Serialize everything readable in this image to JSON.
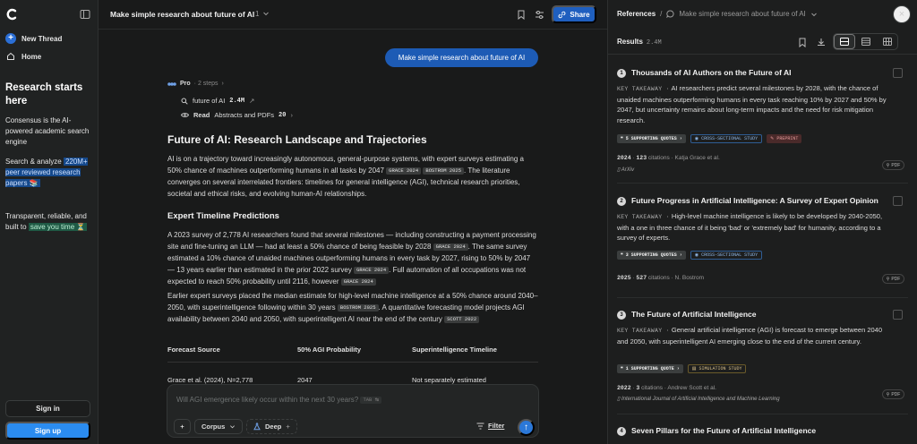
{
  "sidebar": {
    "new_thread": "New Thread",
    "home": "Home",
    "promo_title": "Research starts here",
    "promo_1": "Consensus is the AI-powered academic search engine",
    "promo_2_a": "Search & analyze",
    "promo_2_hl": "220M+ peer reviewed research papers 📚",
    "promo_3_a": "Transparent, reliable, and built to",
    "promo_3_hl": "save you time ⏳",
    "signin": "Sign in",
    "signup": "Sign up"
  },
  "topbar": {
    "title": "Make simple research about future of AI",
    "count": "1",
    "share": "Share"
  },
  "thread": {
    "user_query": "Make simple research about future of AI",
    "pro_label": "Pro",
    "steps": "· 2 steps",
    "step1_text": "future of AI",
    "step1_count": "2.4M",
    "step2_label": "Read",
    "step2_text": "Abstracts and PDFs",
    "step2_count": "20",
    "heading": "Future of AI: Research Landscape and Trajectories",
    "p1": "AI is on a trajectory toward increasingly autonomous, general-purpose systems, with expert surveys estimating a 50% chance of machines outperforming humans in all tasks by 2047",
    "p1_cite1": "GRACE 2024",
    "p1_cite2": "BOSTROM 2025",
    "p1_b": ". The literature converges on several interrelated frontiers: timelines for general intelligence (AGI), technical research priorities, societal and ethical risks, and evolving human-AI relationships.",
    "h2": "Expert Timeline Predictions",
    "p2_a": "A 2023 survey of 2,778 AI researchers found that several milestones — including constructing a payment processing site and fine-tuning an LLM — had at least a 50% chance of being feasible by 2028",
    "p2_c1": "GRACE 2024",
    "p2_b": ". The same survey estimated a 10% chance of unaided machines outperforming humans in every task by 2027, rising to 50% by 2047 — 13 years earlier than estimated in the prior 2022 survey",
    "p2_c2": "GRACE 2024",
    "p2_c": ". Full automation of all occupations was not expected to reach 50% probability until 2116, however",
    "p2_c3": "GRACE 2024",
    "p3_a": "Earlier expert surveys placed the median estimate for high-level machine intelligence at a 50% chance around 2040–2050, with superintelligence following within 30 years",
    "p3_c1": "BOSTROM 2025",
    "p3_b": ". A quantitative forecasting model projects AGI availability between 2040 and 2050, with superintelligent AI near the end of the century",
    "p3_c2": "SCOTT 2022",
    "table": {
      "headers": [
        "Forecast Source",
        "50% AGI Probability",
        "Superintelligence Timeline"
      ],
      "row1": [
        "Grace et al. (2024), N=2,778",
        "2047",
        "Not separately estimated"
      ]
    }
  },
  "composer": {
    "placeholder": "Will AGI emergence likely occur within the next 30 years?",
    "placeholder_tag": "TAB ↹",
    "plus": "+",
    "corpus": "Corpus",
    "deep": "Deep",
    "filter": "Filter"
  },
  "references": {
    "title": "References",
    "sep": "/",
    "subtitle": "Make simple research about future of AI",
    "results_label": "Results",
    "results_count": "2.4M",
    "cards": [
      {
        "num": "1",
        "title": "Thousands of AI Authors on the Future of AI",
        "kt_label": "KEY TAKEAWAY ·",
        "kt": "AI researchers predict several milestones by 2028, with the chance of unaided machines outperforming humans in every task reaching 10% by 2027 and 50% by 2047, but uncertainty remains about long-term impacts and the need for risk mitigation research.",
        "tag_quotes": "5 SUPPORTING QUOTES ›",
        "tag_study": "CROSS-SECTIONAL STUDY",
        "tag_extra": "PREPRINT",
        "year": "2024",
        "citations": "123",
        "citations_label": "citations",
        "authors": "Katja Grace et al.",
        "journal": "ArXiv",
        "pdf": "PDF"
      },
      {
        "num": "2",
        "title": "Future Progress in Artificial Intelligence: A Survey of Expert Opinion",
        "kt_label": "KEY TAKEAWAY ·",
        "kt": "High-level machine intelligence is likely to be developed by 2040-2050, with a one in three chance of it being 'bad' or 'extremely bad' for humanity, according to a survey of experts.",
        "tag_quotes": "3 SUPPORTING QUOTES ›",
        "tag_study": "CROSS-SECTIONAL STUDY",
        "year": "2025",
        "citations": "527",
        "citations_label": "citations",
        "authors": "N. Bostrom",
        "pdf": "PDF"
      },
      {
        "num": "3",
        "title": "The Future of Artificial Intelligence",
        "kt_label": "KEY TAKEAWAY ·",
        "kt": "General artificial intelligence (AGI) is forecast to emerge between 2040 and 2050, with superintelligent AI emerging close to the end of the current century.",
        "tag_quotes": "1 SUPPORTING QUOTE ›",
        "tag_study": "SIMULATION STUDY",
        "year": "2022",
        "citations": "3",
        "citations_label": "citations",
        "authors": "Andrew Scott et al.",
        "journal": "International Journal of Artificial Intelligence and Machine Learning",
        "pdf": "PDF"
      },
      {
        "num": "4",
        "title": "Seven Pillars for the Future of Artificial Intelligence"
      }
    ]
  }
}
